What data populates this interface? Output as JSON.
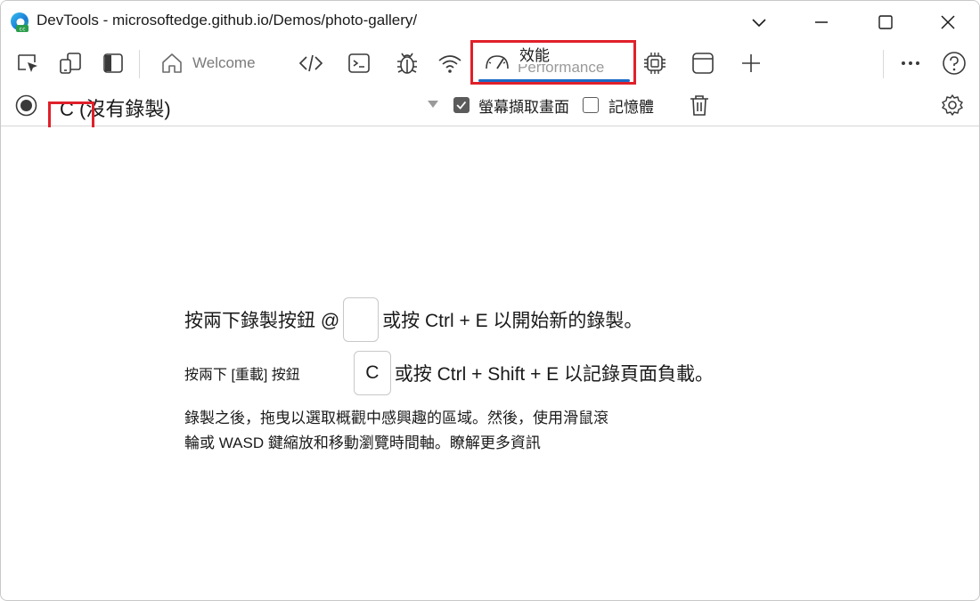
{
  "window": {
    "title": "DevTools - microsoftedge.github.io/Demos/photo-gallery/"
  },
  "toolbar": {
    "welcome_tab": "Welcome",
    "performance_tab_label": "效能",
    "performance_tab_underlabel": "Performance"
  },
  "perf_toolbar": {
    "recording_select": "C (沒有錄製)",
    "screenshots_label": "螢幕擷取畫面",
    "screenshots_checked": true,
    "memory_label": "記憶體",
    "memory_checked": false
  },
  "main": {
    "line1_a": "按兩下錄製按鈕 @",
    "line1_b": "或按 Ctrl + E 以開始新的錄製。",
    "line2_small": "按兩下 [重載] 按鈕",
    "line2_key": "C",
    "line2_b": "或按 Ctrl + Shift + E 以記錄頁面負載。",
    "para_1": "錄製之後，拖曳以選取概觀中感興趣的區域。然後，使用滑鼠滾",
    "para_2": "輪或 WASD 鍵縮放和移動瀏覽時間軸。瞭解更多資訊"
  },
  "colors": {
    "highlight": "#e0202a",
    "accent": "#1a6cc7"
  }
}
